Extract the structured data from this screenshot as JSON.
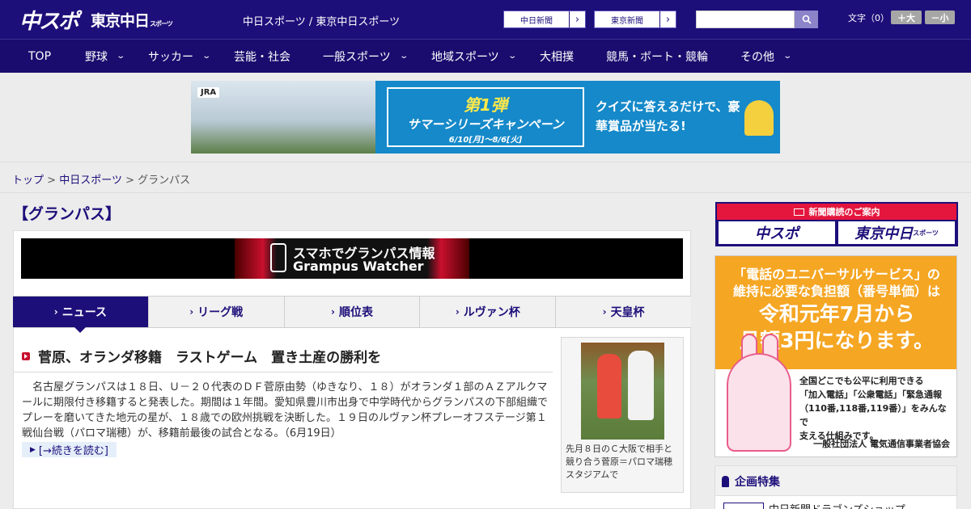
{
  "header": {
    "logo_main": "中スポ",
    "logo_tokyo": "東京中日",
    "logo_tokyo_suffix": "スポーツ",
    "site_title": "中日スポーツ / 東京中日スポーツ",
    "chunichi_btn": "中日新聞",
    "tokyo_btn": "東京新聞",
    "search_placeholder": "",
    "fontsize_label": "文字（0）",
    "font_bigger": "＋大",
    "font_smaller": "－小"
  },
  "nav": {
    "items": [
      {
        "label": "TOP",
        "has_menu": false
      },
      {
        "label": "野球",
        "has_menu": true
      },
      {
        "label": "サッカー",
        "has_menu": true
      },
      {
        "label": "芸能・社会",
        "has_menu": false
      },
      {
        "label": "一般スポーツ",
        "has_menu": true
      },
      {
        "label": "地域スポーツ",
        "has_menu": true
      },
      {
        "label": "大相撲",
        "has_menu": false
      },
      {
        "label": "競馬・ボート・競輪",
        "has_menu": false
      },
      {
        "label": "その他",
        "has_menu": true
      }
    ]
  },
  "banner": {
    "brand": "JRA",
    "title": "第1弾",
    "campaign": "サマーシリーズキャンペーン",
    "dates": "6/10[月]～8/6[火]",
    "copy": "クイズに答えるだけで、豪華賞品が当たる!"
  },
  "breadcrumb": {
    "top": "トップ",
    "chunichi": "中日スポーツ",
    "current": "グランパス",
    "sep": ">"
  },
  "page_title": "【グランパス】",
  "grampus_banner": {
    "line1": "スマホでグランパス情報",
    "line2": "Grampus Watcher"
  },
  "tabs": [
    {
      "label": "ニュース",
      "active": true
    },
    {
      "label": "リーグ戦",
      "active": false
    },
    {
      "label": "順位表",
      "active": false
    },
    {
      "label": "ルヴァン杯",
      "active": false
    },
    {
      "label": "天皇杯",
      "active": false
    }
  ],
  "article": {
    "headline": "菅原、オランダ移籍　ラストゲーム　置き土産の勝利を",
    "body": "名古屋グランパスは１８日、Ｕ－２０代表のＤＦ菅原由勢（ゆきなり、１８）がオランダ１部のＡＺアルクマールに期限付き移籍すると発表した。期間は１年間。愛知県豊川市出身で中学時代からグランパスの下部組織でプレーを磨いてきた地元の星が、１８歳での欧州挑戦を決断した。１９日のルヴァン杯プレーオフステージ第１戦仙台戦（パロマ瑞穂）が、移籍前最後の試合となる。（6月19日）",
    "more": "[→続きを読む]",
    "photo_caption": "先月８日のＣ大阪で相手と競り合う菅原＝パロマ瑞穂スタジアムで"
  },
  "sidebar": {
    "subscribe_title": "新聞購読のご案内",
    "subscribe_logo1": "中スポ",
    "subscribe_logo2": "東京中日",
    "subscribe_logo2_suffix": "スポーツ",
    "ad_line1": "「電話のユニバーサルサービス」の",
    "ad_line2": "維持に必要な負担額（番号単価）は",
    "ad_big1": "令和元年7月から",
    "ad_big2": "月額3円になります。",
    "ad_desc1": "全国どこでも公平に利用できる",
    "ad_desc2": "「加入電話」「公衆電話」「緊急通報",
    "ad_desc3": "（110番,118番,119番）」をみんなで",
    "ad_desc4": "支える仕組みです。",
    "ad_org": "一般社団法人 電気通信事業者協会",
    "special_title": "企画特集",
    "special_item": "中日新聞ドラゴンズショップ"
  },
  "colors": {
    "header_bg": "#1d0f7a",
    "accent_red": "#c8102e",
    "ad_orange": "#f5a623"
  }
}
